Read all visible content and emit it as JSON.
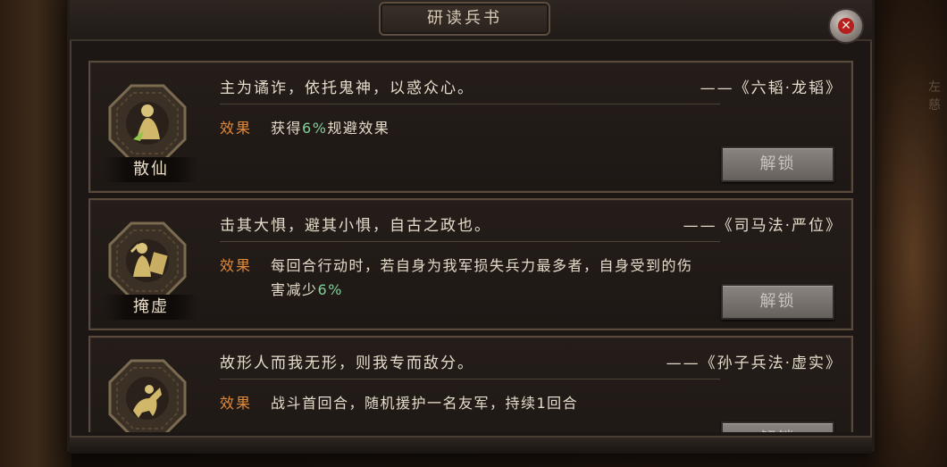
{
  "window": {
    "title": "研读兵书",
    "close_icon": "close-icon"
  },
  "background": {
    "side_text": "左慈"
  },
  "cards": [
    {
      "skill_name": "散仙",
      "icon": "figure-meditating-icon",
      "quote": "主为谲诈，依托鬼神，以惑众心。",
      "source": "——《六韬·龙韬》",
      "effect_label": "效果",
      "effect_prefix": "获得",
      "effect_highlight": "6%",
      "effect_suffix": "规避效果",
      "unlock_label": "解锁"
    },
    {
      "skill_name": "掩虚",
      "icon": "figure-shield-icon",
      "quote": "击其大惧，避其小惧，自古之政也。",
      "source": "——《司马法·严位》",
      "effect_label": "效果",
      "effect_prefix": "每回合行动时，若自身为我军损失兵力最多者，自身受到的伤害减少",
      "effect_highlight": "6%",
      "effect_suffix": "",
      "unlock_label": "解锁"
    },
    {
      "skill_name": "",
      "icon": "horse-rider-icon",
      "quote": "故形人而我无形，则我专而敌分。",
      "source": "——《孙子兵法·虚实》",
      "effect_label": "效果",
      "effect_prefix": "战斗首回合，随机援护一名友军，持续1回合",
      "effect_highlight": "",
      "effect_suffix": "",
      "unlock_label": "解锁"
    }
  ],
  "colors": {
    "effect_label": "#e08a3a",
    "highlight": "#7fd19a",
    "text": "#e6dccb"
  }
}
